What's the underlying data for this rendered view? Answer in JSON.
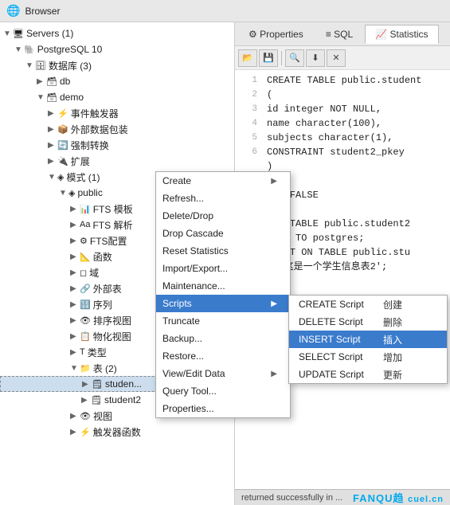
{
  "titleBar": {
    "icon": "🌐",
    "title": "Browser"
  },
  "tabs": [
    {
      "id": "properties",
      "label": "Properties",
      "icon": "⚙"
    },
    {
      "id": "sql",
      "label": "SQL",
      "icon": "≡"
    },
    {
      "id": "statistics",
      "label": "Statistics",
      "icon": "📈"
    }
  ],
  "toolbar": {
    "buttons": [
      "📂",
      "💾",
      "🔍",
      "⬇",
      "✕"
    ]
  },
  "tree": {
    "items": [
      {
        "indent": 0,
        "arrow": "▼",
        "icon": "🖥",
        "label": "Servers (1)"
      },
      {
        "indent": 1,
        "arrow": "▼",
        "icon": "🐘",
        "label": "PostgreSQL 10"
      },
      {
        "indent": 2,
        "arrow": "▼",
        "icon": "🗄",
        "label": "数据库 (3)"
      },
      {
        "indent": 3,
        "arrow": "▶",
        "icon": "🗃",
        "label": "db"
      },
      {
        "indent": 3,
        "arrow": "▼",
        "icon": "🗃",
        "label": "demo"
      },
      {
        "indent": 4,
        "arrow": "▶",
        "icon": "⚡",
        "label": "事件触发器"
      },
      {
        "indent": 4,
        "arrow": "▶",
        "icon": "📦",
        "label": "外部数据包装"
      },
      {
        "indent": 4,
        "arrow": "▶",
        "icon": "🔄",
        "label": "强制转换"
      },
      {
        "indent": 4,
        "arrow": "▶",
        "icon": "🔌",
        "label": "扩展"
      },
      {
        "indent": 4,
        "arrow": "▼",
        "icon": "◈",
        "label": "模式 (1)"
      },
      {
        "indent": 5,
        "arrow": "▼",
        "icon": "◈",
        "label": "public"
      },
      {
        "indent": 6,
        "arrow": "▶",
        "icon": "📊",
        "label": "FTS 模板"
      },
      {
        "indent": 6,
        "arrow": "▶",
        "icon": "Aa",
        "label": "FTS 解析"
      },
      {
        "indent": 6,
        "arrow": "▶",
        "icon": "⚙",
        "label": "FTS配置"
      },
      {
        "indent": 6,
        "arrow": "▶",
        "icon": "📐",
        "label": "函数"
      },
      {
        "indent": 6,
        "arrow": "▶",
        "icon": "◻",
        "label": "域"
      },
      {
        "indent": 6,
        "arrow": "▶",
        "icon": "🔗",
        "label": "外部表"
      },
      {
        "indent": 6,
        "arrow": "▶",
        "icon": "🔢",
        "label": "序列"
      },
      {
        "indent": 6,
        "arrow": "▶",
        "icon": "👁",
        "label": "排序视图"
      },
      {
        "indent": 6,
        "arrow": "▶",
        "icon": "📋",
        "label": "物化视图"
      },
      {
        "indent": 6,
        "arrow": "▶",
        "icon": "T",
        "label": "类型"
      },
      {
        "indent": 6,
        "arrow": "▼",
        "icon": "📁",
        "label": "表 (2)"
      },
      {
        "indent": 7,
        "arrow": "▶",
        "icon": "🗒",
        "label": "studen...",
        "selected": true
      },
      {
        "indent": 7,
        "arrow": "▶",
        "icon": "🗒",
        "label": "student2"
      },
      {
        "indent": 6,
        "arrow": "▶",
        "icon": "👁",
        "label": "视图"
      },
      {
        "indent": 6,
        "arrow": "▶",
        "icon": "⚡",
        "label": "触发器函数"
      }
    ]
  },
  "codeLines": [
    {
      "num": "1",
      "text": "CREATE TABLE public.student"
    },
    {
      "num": "2",
      "text": "("
    },
    {
      "num": "3",
      "text": "  id integer NOT NULL,"
    },
    {
      "num": "4",
      "text": "  name character(100),"
    },
    {
      "num": "5",
      "text": "  subjects character(1),"
    },
    {
      "num": "6",
      "text": "  CONSTRAINT student2_pkey"
    },
    {
      "num": "",
      "text": ")"
    },
    {
      "num": "",
      "text": "H ("
    },
    {
      "num": "",
      "text": "IDS=FALSE"
    },
    {
      "num": "",
      "text": ""
    },
    {
      "num": "",
      "text": "IER TABLE public.student2"
    },
    {
      "num": "",
      "text": "WNER TO postgres;"
    },
    {
      "num": "",
      "text": "IMENT ON TABLE public.stu"
    },
    {
      "num": "",
      "text": "S '这是一个学生信息表2';"
    }
  ],
  "contextMenu": {
    "items": [
      {
        "id": "create",
        "label": "Create",
        "hasArrow": true
      },
      {
        "id": "refresh",
        "label": "Refresh...",
        "hasArrow": false
      },
      {
        "id": "delete",
        "label": "Delete/Drop",
        "hasArrow": false
      },
      {
        "id": "drop-cascade",
        "label": "Drop Cascade",
        "hasArrow": false
      },
      {
        "id": "reset-stats",
        "label": "Reset Statistics",
        "hasArrow": false
      },
      {
        "id": "import-export",
        "label": "Import/Export...",
        "hasArrow": false
      },
      {
        "id": "maintenance",
        "label": "Maintenance...",
        "hasArrow": false
      },
      {
        "id": "scripts",
        "label": "Scripts",
        "hasArrow": true,
        "highlighted": true
      },
      {
        "id": "truncate",
        "label": "Truncate",
        "hasArrow": false
      },
      {
        "id": "backup",
        "label": "Backup...",
        "hasArrow": false
      },
      {
        "id": "restore",
        "label": "Restore...",
        "hasArrow": false
      },
      {
        "id": "view-edit",
        "label": "View/Edit Data",
        "hasArrow": true
      },
      {
        "id": "query-tool",
        "label": "Query Tool...",
        "hasArrow": false
      },
      {
        "id": "properties",
        "label": "Properties...",
        "hasArrow": false
      }
    ]
  },
  "subMenu": {
    "items": [
      {
        "id": "create-script",
        "labelEn": "CREATE Script",
        "labelCn": "创建",
        "selected": false
      },
      {
        "id": "delete-script",
        "labelEn": "DELETE Script",
        "labelCn": "删除",
        "selected": false
      },
      {
        "id": "insert-script",
        "labelEn": "INSERT Script",
        "labelCn": "插入",
        "selected": true
      },
      {
        "id": "select-script",
        "labelEn": "SELECT Script",
        "labelCn": "增加",
        "selected": false
      },
      {
        "id": "update-script",
        "labelEn": "UPDATE Script",
        "labelCn": "更新",
        "selected": false
      }
    ]
  },
  "statusBar": {
    "left": "returned successfully in ...",
    "logo": "FANQU趋",
    "cuel": "cuel.cn"
  }
}
